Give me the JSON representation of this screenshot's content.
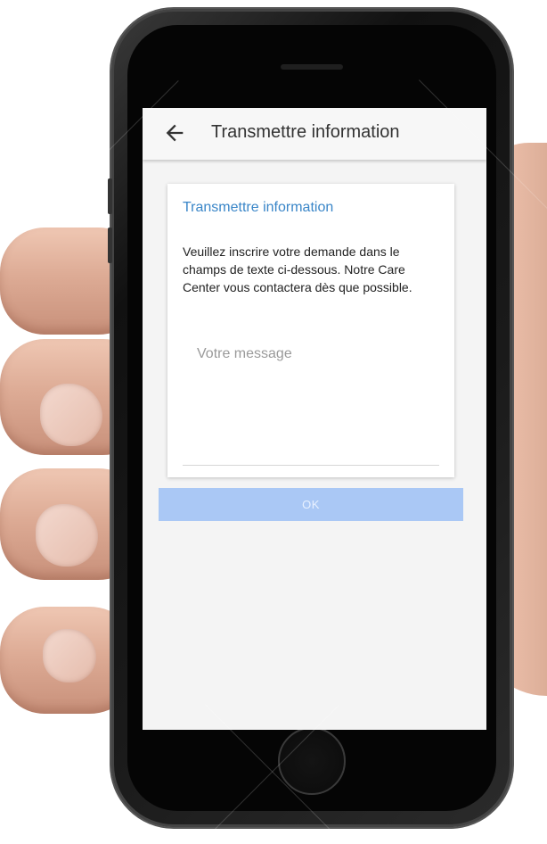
{
  "appbar": {
    "title": "Transmettre information",
    "back_icon": "arrow-left-icon"
  },
  "card": {
    "title": "Transmettre information",
    "description": "Veuillez inscrire votre demande dans le champs de texte ci-dessous. Notre Care Center vous contactera dès que possible.",
    "message_placeholder": "Votre message",
    "message_value": ""
  },
  "actions": {
    "ok_label": "OK"
  },
  "colors": {
    "accent": "#3a86c8",
    "button_bg": "#aac8f5",
    "screen_bg": "#f4f4f4"
  }
}
